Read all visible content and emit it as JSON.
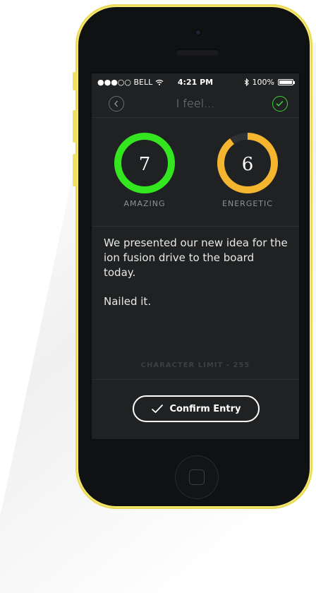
{
  "status_bar": {
    "signal": "●●●○○",
    "carrier": "BELL",
    "time": "4:21 PM",
    "battery": "100%"
  },
  "nav": {
    "title": "I feel...",
    "back_icon": "chevron-left-icon",
    "confirm_icon": "check-circle-icon"
  },
  "moods": [
    {
      "value": "7",
      "label": "AMAZING",
      "color": "#33e61f",
      "fill": 1.0
    },
    {
      "value": "6",
      "label": "ENERGETIC",
      "color": "#f5b52e",
      "fill": 0.9
    }
  ],
  "entry": {
    "paragraph1": "We presented our new idea for the ion fusion drive to the board today.",
    "paragraph2": "Nailed it."
  },
  "character_limit": "CHARACTER LIMIT - 255",
  "confirm_button": {
    "label": "Confirm Entry",
    "icon": "check-icon"
  },
  "colors": {
    "phone_body": "#f5e86a",
    "screen_bg": "#1f2122",
    "accent_green": "#33e61f",
    "accent_orange": "#f5b52e",
    "ring_track": "#2e3032"
  }
}
